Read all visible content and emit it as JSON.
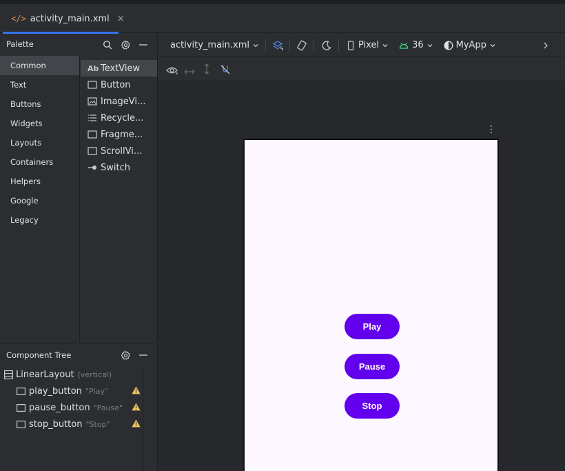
{
  "editor_tab": {
    "icon": "xml-file-icon",
    "label": "activity_main.xml",
    "close": "×"
  },
  "palette": {
    "title": "Palette",
    "categories": [
      "Common",
      "Text",
      "Buttons",
      "Widgets",
      "Layouts",
      "Containers",
      "Helpers",
      "Google",
      "Legacy"
    ],
    "selected_category": "Common",
    "items": [
      {
        "label": "TextView",
        "icon": "textview-icon",
        "glyph": "Ab"
      },
      {
        "label": "Button",
        "icon": "button-icon"
      },
      {
        "label": "ImageVi...",
        "icon": "imageview-icon"
      },
      {
        "label": "Recycle...",
        "icon": "recyclerview-icon"
      },
      {
        "label": "Fragme...",
        "icon": "fragment-icon"
      },
      {
        "label": "ScrollVi...",
        "icon": "scrollview-icon"
      },
      {
        "label": "Switch",
        "icon": "switch-icon"
      }
    ]
  },
  "component_tree": {
    "title": "Component Tree",
    "root": {
      "label": "LinearLayout",
      "sub": "(vertical)"
    },
    "children": [
      {
        "label": "play_button",
        "sub": "\"Play\""
      },
      {
        "label": "pause_button",
        "sub": "\"Pause\""
      },
      {
        "label": "stop_button",
        "sub": "\"Stop\""
      }
    ]
  },
  "design_toolbar": {
    "file": "activity_main.xml",
    "device": "Pixel",
    "api": "36",
    "theme": "MyApp"
  },
  "app_preview": {
    "buttons": [
      "Play",
      "Pause",
      "Stop"
    ],
    "button_color": "#6200ee",
    "background": "#fdf7ff"
  },
  "colors": {
    "accent": "#3574f0",
    "warning": "#f2c55c",
    "android_green": "#3ddc84"
  }
}
